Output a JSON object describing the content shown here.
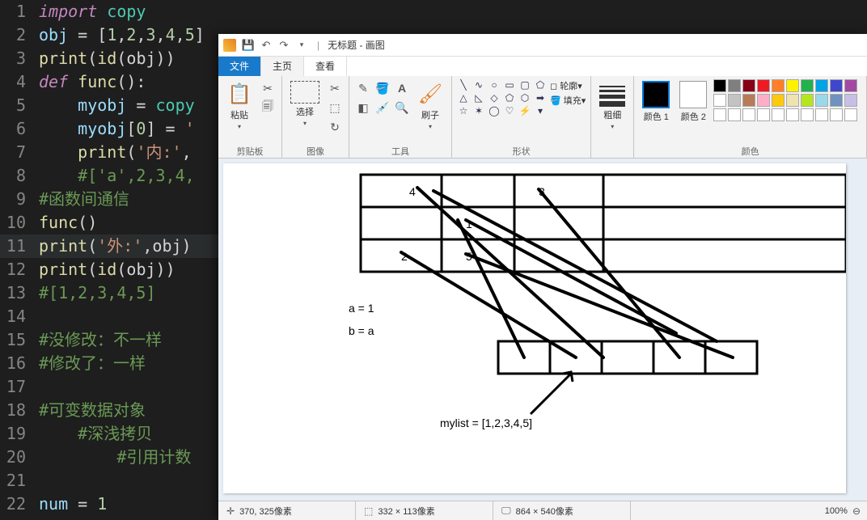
{
  "editor": {
    "lines": [
      {
        "n": "1",
        "tokens": [
          {
            "t": "import",
            "c": "kw"
          },
          {
            "t": " copy",
            "c": "bi"
          }
        ]
      },
      {
        "n": "2",
        "tokens": [
          {
            "t": "obj ",
            "c": "nm"
          },
          {
            "t": "= ",
            "c": "pn"
          },
          {
            "t": "[",
            "c": "pn"
          },
          {
            "t": "1",
            "c": "num"
          },
          {
            "t": ",",
            "c": "pn"
          },
          {
            "t": "2",
            "c": "num"
          },
          {
            "t": ",",
            "c": "pn"
          },
          {
            "t": "3",
            "c": "num"
          },
          {
            "t": ",",
            "c": "pn"
          },
          {
            "t": "4",
            "c": "num"
          },
          {
            "t": ",",
            "c": "pn"
          },
          {
            "t": "5",
            "c": "num"
          },
          {
            "t": "]",
            "c": "pn"
          }
        ]
      },
      {
        "n": "3",
        "tokens": [
          {
            "t": "print",
            "c": "fn"
          },
          {
            "t": "(",
            "c": "pn"
          },
          {
            "t": "id",
            "c": "fn"
          },
          {
            "t": "(obj))",
            "c": "pn"
          }
        ]
      },
      {
        "n": "4",
        "tokens": [
          {
            "t": "def ",
            "c": "kw"
          },
          {
            "t": "func",
            "c": "fn"
          },
          {
            "t": "():",
            "c": "pn"
          }
        ]
      },
      {
        "n": "5",
        "tokens": [
          {
            "t": "    myobj ",
            "c": "nm"
          },
          {
            "t": "= ",
            "c": "pn"
          },
          {
            "t": "copy",
            "c": "bi"
          }
        ]
      },
      {
        "n": "6",
        "tokens": [
          {
            "t": "    myobj",
            "c": "nm"
          },
          {
            "t": "[",
            "c": "pn"
          },
          {
            "t": "0",
            "c": "num"
          },
          {
            "t": "] = ",
            "c": "pn"
          },
          {
            "t": "'",
            "c": "str"
          }
        ]
      },
      {
        "n": "7",
        "tokens": [
          {
            "t": "    ",
            "c": "pn"
          },
          {
            "t": "print",
            "c": "fn"
          },
          {
            "t": "(",
            "c": "pn"
          },
          {
            "t": "'内:'",
            "c": "str"
          },
          {
            "t": ",",
            "c": "pn"
          }
        ]
      },
      {
        "n": "8",
        "tokens": [
          {
            "t": "    ",
            "c": "pn"
          },
          {
            "t": "#['a',2,3,4,",
            "c": "cm"
          }
        ]
      },
      {
        "n": "9",
        "tokens": [
          {
            "t": "#函数间通信",
            "c": "cm"
          }
        ]
      },
      {
        "n": "10",
        "tokens": [
          {
            "t": "func",
            "c": "fn"
          },
          {
            "t": "()",
            "c": "pn"
          }
        ]
      },
      {
        "n": "11",
        "tokens": [
          {
            "t": "print",
            "c": "fn"
          },
          {
            "t": "(",
            "c": "pn"
          },
          {
            "t": "'外:'",
            "c": "str"
          },
          {
            "t": ",obj)",
            "c": "pn"
          }
        ]
      },
      {
        "n": "12",
        "tokens": [
          {
            "t": "print",
            "c": "fn"
          },
          {
            "t": "(",
            "c": "pn"
          },
          {
            "t": "id",
            "c": "fn"
          },
          {
            "t": "(obj))",
            "c": "pn"
          }
        ]
      },
      {
        "n": "13",
        "tokens": [
          {
            "t": "#[1,2,3,4,5]",
            "c": "cm"
          }
        ]
      },
      {
        "n": "14",
        "tokens": []
      },
      {
        "n": "15",
        "tokens": [
          {
            "t": "#没修改：不一样",
            "c": "cm"
          }
        ]
      },
      {
        "n": "16",
        "tokens": [
          {
            "t": "#修改了：一样",
            "c": "cm"
          }
        ]
      },
      {
        "n": "17",
        "tokens": []
      },
      {
        "n": "18",
        "tokens": [
          {
            "t": "#可变数据对象",
            "c": "cm"
          }
        ]
      },
      {
        "n": "19",
        "tokens": [
          {
            "t": "    ",
            "c": "pn"
          },
          {
            "t": "#深浅拷贝",
            "c": "cm"
          }
        ]
      },
      {
        "n": "20",
        "tokens": [
          {
            "t": "        ",
            "c": "pn"
          },
          {
            "t": "#引用计数",
            "c": "cm"
          }
        ]
      },
      {
        "n": "21",
        "tokens": []
      },
      {
        "n": "22",
        "tokens": [
          {
            "t": "num ",
            "c": "nm"
          },
          {
            "t": "= ",
            "c": "pn"
          },
          {
            "t": "1",
            "c": "num"
          }
        ]
      }
    ],
    "hl_line": 11
  },
  "paint": {
    "title": "无标题 - 画图",
    "tabs": {
      "file": "文件",
      "home": "主页",
      "view": "查看"
    },
    "ribbon": {
      "clipboard": {
        "title": "剪贴板",
        "paste": "粘贴"
      },
      "image": {
        "title": "图像",
        "select": "选择"
      },
      "tools": {
        "title": "工具",
        "brushes": "刷子"
      },
      "shapes": {
        "title": "形状",
        "outline": "轮廓",
        "fill": "填充"
      },
      "thickness": {
        "title": "粗细"
      },
      "colors": {
        "title": "颜色",
        "c1": "颜色 1",
        "c2": "颜色 2"
      }
    },
    "palette_colors": [
      "#000000",
      "#7f7f7f",
      "#880015",
      "#ed1c24",
      "#ff7f27",
      "#fff200",
      "#22b14c",
      "#00a2e8",
      "#3f48cc",
      "#a349a4",
      "#ffffff",
      "#c3c3c3",
      "#b97a57",
      "#ffaec9",
      "#ffc90e",
      "#efe4b0",
      "#b5e61d",
      "#99d9ea",
      "#7092be",
      "#c8bfe7",
      "#ffffff",
      "#ffffff",
      "#ffffff",
      "#ffffff",
      "#ffffff",
      "#ffffff",
      "#ffffff",
      "#ffffff",
      "#ffffff",
      "#ffffff"
    ],
    "canvas": {
      "grid_cells": [
        "4",
        "3",
        "",
        "1",
        "",
        "",
        "2",
        "5",
        ""
      ],
      "text_a": "a = 1",
      "text_b": "b = a",
      "text_mylist": "mylist = [1,2,3,4,5]"
    },
    "status": {
      "cursor": "370, 325像素",
      "selection": "332 × 113像素",
      "canvas_size": "864 × 540像素",
      "zoom": "100%"
    }
  }
}
